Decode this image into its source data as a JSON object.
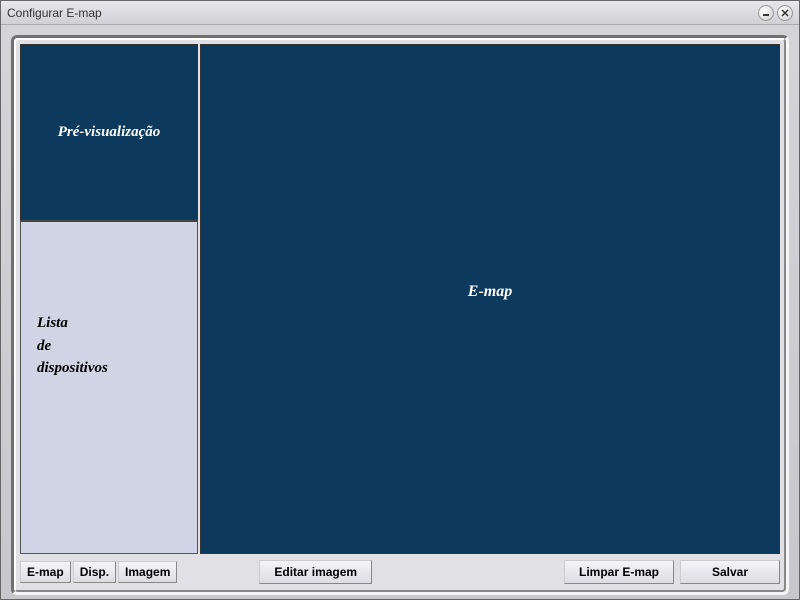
{
  "window": {
    "title": "Configurar E-map"
  },
  "panes": {
    "preview_label": "Pré-visualização",
    "device_list_label": "Lista\nde\ndispositivos",
    "map_label": "E-map"
  },
  "tabs": {
    "emap": "E-map",
    "disp": "Disp.",
    "imagem": "Imagem"
  },
  "buttons": {
    "edit_image": "Editar imagem",
    "clear_emap": "Limpar E-map",
    "save": "Salvar"
  }
}
